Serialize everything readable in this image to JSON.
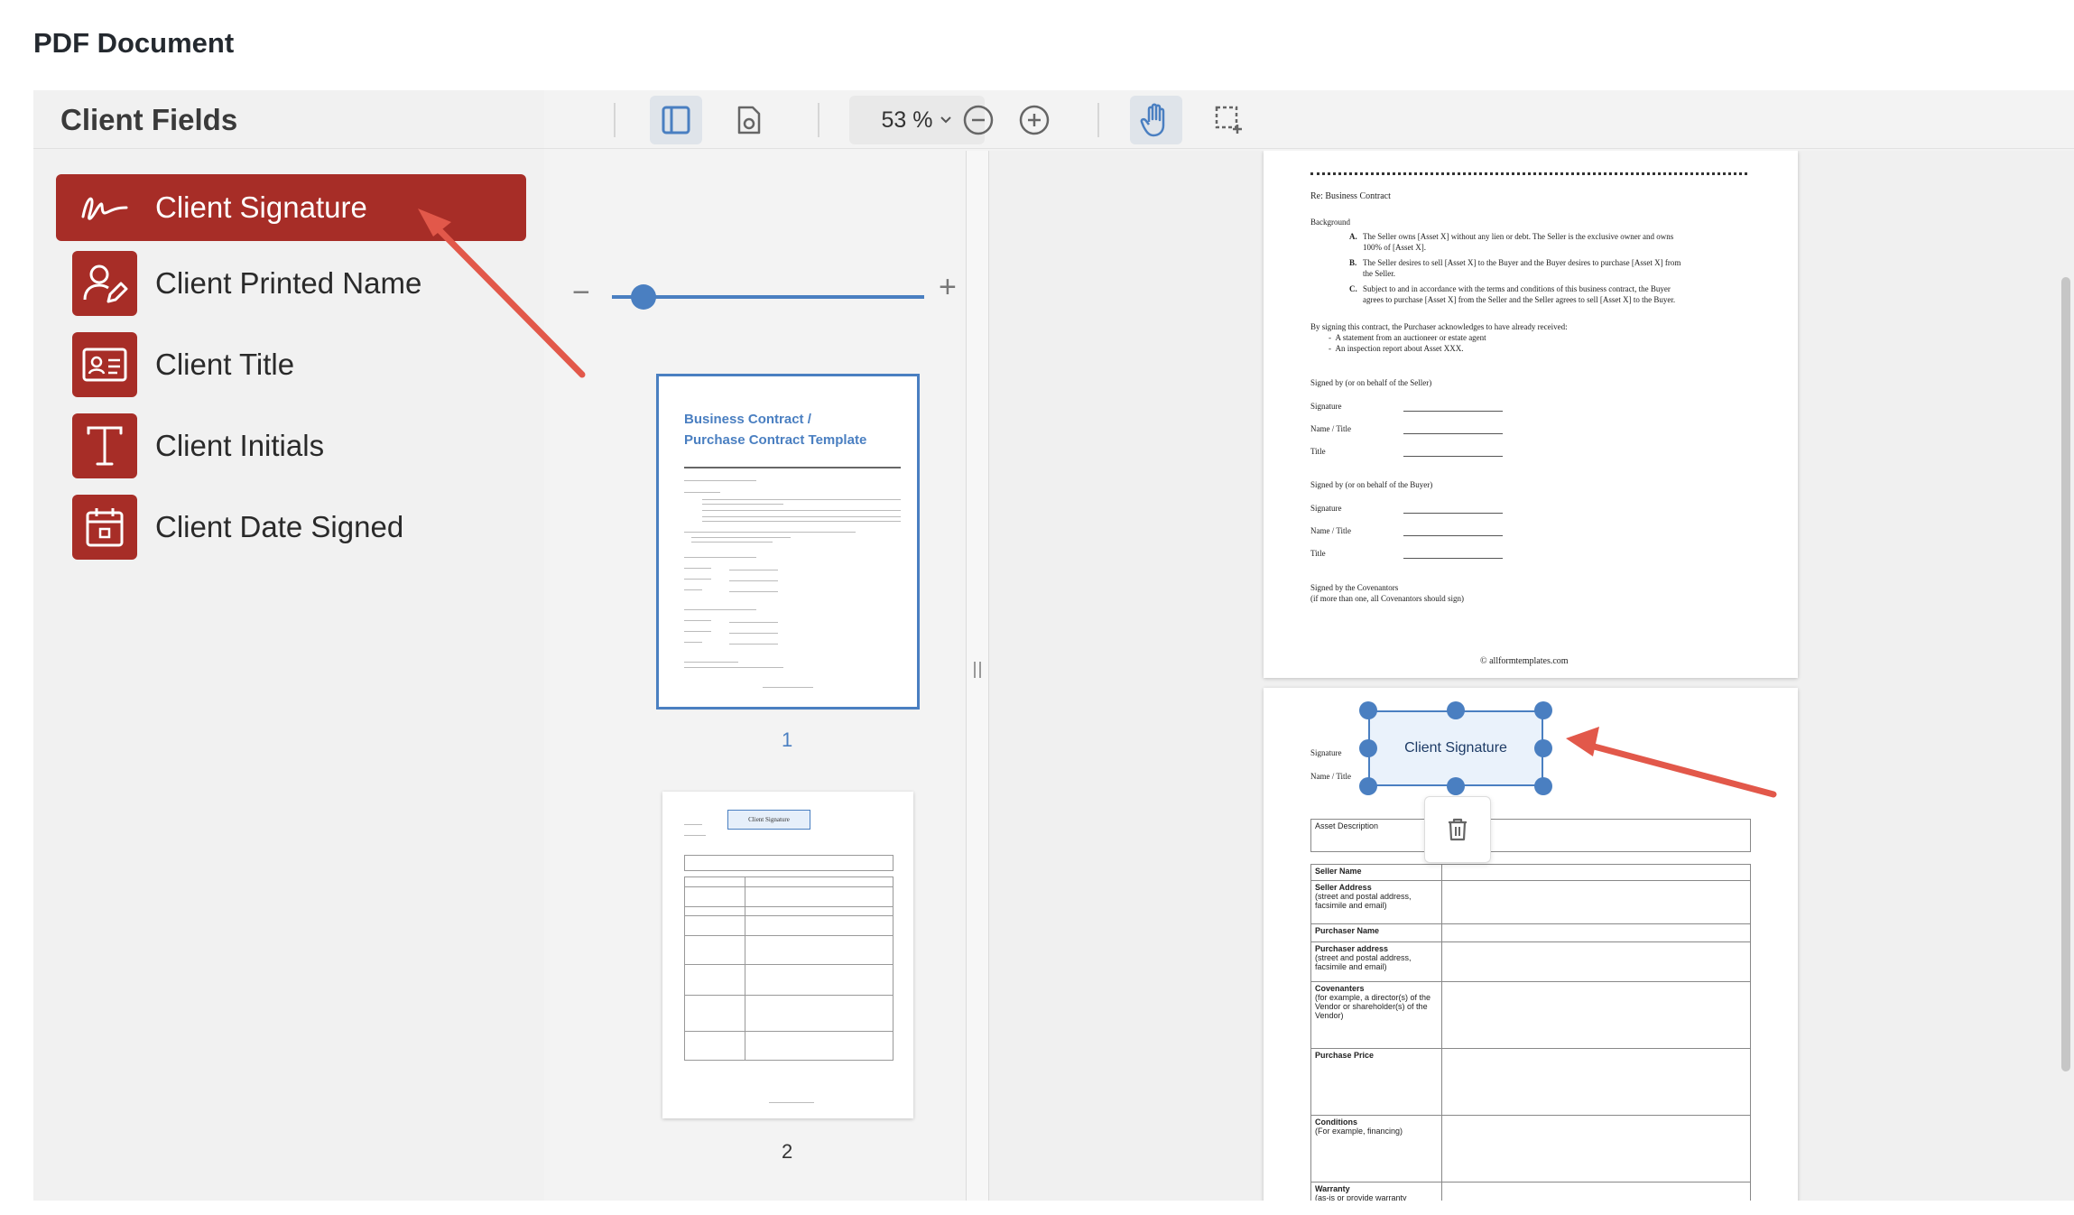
{
  "page_title": "PDF Document",
  "left_panel": {
    "title": "Client Fields",
    "items": [
      {
        "label": "Client Signature",
        "icon": "signature-icon",
        "active": true
      },
      {
        "label": "Client Printed Name",
        "icon": "user-edit-icon",
        "active": false
      },
      {
        "label": "Client Title",
        "icon": "id-card-icon",
        "active": false
      },
      {
        "label": "Client Initials",
        "icon": "text-t-icon",
        "active": false
      },
      {
        "label": "Client Date Signed",
        "icon": "calendar-icon",
        "active": false
      }
    ]
  },
  "toolbar": {
    "zoom": "53 %",
    "tools": [
      "sidebar-toggle-icon",
      "document-settings-icon",
      "zoom-out-icon",
      "zoom-in-icon",
      "hand-tool-icon",
      "marquee-select-icon"
    ]
  },
  "thumbnails": {
    "slider_value": 0.1,
    "pages": [
      {
        "number": "1",
        "title_line1": "Business Contract /",
        "title_line2": "Purchase Contract Template",
        "selected": true
      },
      {
        "number": "2",
        "selected": false
      }
    ],
    "thumb2_field": "Client Signature"
  },
  "document": {
    "page1": {
      "re": "Re: Business Contract",
      "background": "Background",
      "items": [
        {
          "letter": "A.",
          "text1": "The Seller owns [Asset X] without any lien or debt. The Seller is the exclusive owner and owns",
          "text2": "100% of [Asset X]."
        },
        {
          "letter": "B.",
          "text1": "The Seller desires to sell [Asset X] to the Buyer and the Buyer desires to purchase [Asset X] from",
          "text2": "the Seller."
        },
        {
          "letter": "C.",
          "text1": "Subject to and in accordance with the terms and conditions of this business contract, the Buyer",
          "text2": "agrees to purchase [Asset X] from the Seller and the Seller agrees to sell [Asset X] to the Buyer."
        }
      ],
      "ack": "By signing this contract, the Purchaser acknowledges to have already received:",
      "bullets": [
        "A statement from an auctioneer or estate agent",
        "An inspection report about Asset XXX."
      ],
      "seller_block": "Signed by (or on behalf of the Seller)",
      "buyer_block": "Signed by (or on behalf of the Buyer)",
      "signature_label": "Signature",
      "name_title_label": "Name / Title",
      "title_label": "Title",
      "covenantors": "Signed by the Covenantors",
      "covenantors_note": "(if more than one, all Covenantors should sign)",
      "footer": "© allformtemplates.com"
    },
    "page2": {
      "signature_label": "Signature",
      "name_title_label": "Name / Title",
      "field_label": "Client Signature",
      "asset_description": "Asset Description",
      "rows": [
        {
          "label": "Seller Name",
          "sub": ""
        },
        {
          "label": "Seller Address",
          "sub": "(street and postal address, facsimile and email)"
        },
        {
          "label": "Purchaser Name",
          "sub": ""
        },
        {
          "label": "Purchaser address",
          "sub": "(street and postal address, facsimile and email)"
        },
        {
          "label": "Covenanters",
          "sub": "(for example, a director(s) of the Vendor or shareholder(s) of the Vendor)"
        },
        {
          "label": "Purchase Price",
          "sub": ""
        },
        {
          "label": "Conditions",
          "sub": "(For example, financing)"
        },
        {
          "label": "Warranty",
          "sub": "(as-is or provide warranty"
        }
      ]
    }
  },
  "colors": {
    "brand_red": "#a72d27",
    "accent_blue": "#4a7fc1",
    "arrow": "#e2584a"
  }
}
